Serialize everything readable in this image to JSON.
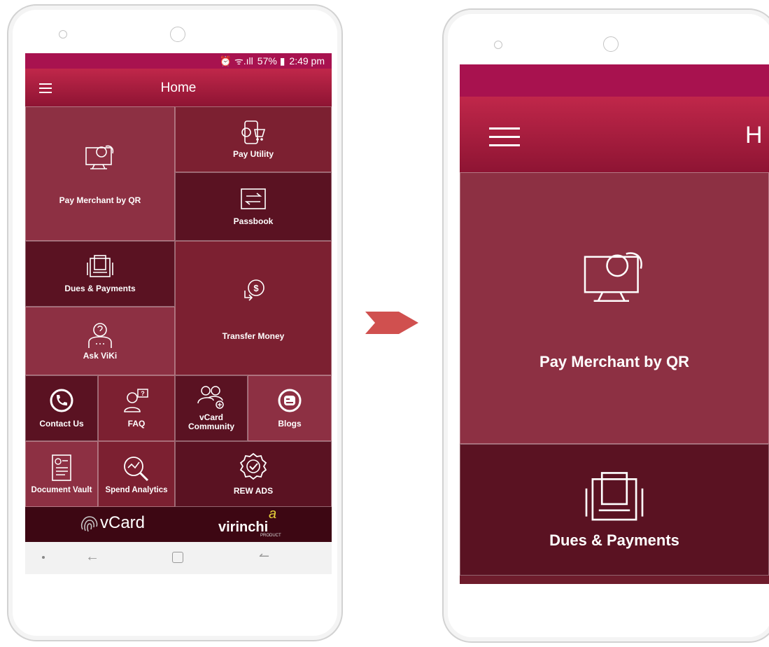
{
  "left_screen": {
    "status": {
      "icons": "⏰ ᯤ.ıll",
      "battery": "57% ▮",
      "time": "2:49 pm"
    },
    "appbar": {
      "title": "Home"
    },
    "tiles": {
      "pay_merchant": "Pay Merchant by QR",
      "pay_utility": "Pay Utility",
      "passbook": "Passbook",
      "dues_payments": "Dues & Payments",
      "ask_viki": "Ask ViKi",
      "transfer_money": "Transfer Money",
      "contact_us": "Contact Us",
      "faq": "FAQ",
      "vcard_community_line1": "vCard",
      "vcard_community_line2": "Community",
      "blogs": "Blogs",
      "document_vault": "Document Vault",
      "spend_analytics": "Spend Analytics",
      "rew_ads": "REW ADS"
    },
    "brand": {
      "vcard": "vCard",
      "virinchi": "virinchi",
      "virinchi_sup": "a",
      "product": "PRODUCT"
    }
  },
  "right_screen": {
    "appbar": {
      "title_partial": "H"
    },
    "tiles": {
      "pay_merchant": "Pay Merchant by QR",
      "dues_payments": "Dues & Payments"
    }
  },
  "colors": {
    "statusbar": "#a8124f",
    "appbar_top": "#c0274a",
    "tile_light": "#8d3043",
    "tile_mid": "#7c2031",
    "tile_dark": "#5a1222",
    "arrow": "#d0504f"
  }
}
